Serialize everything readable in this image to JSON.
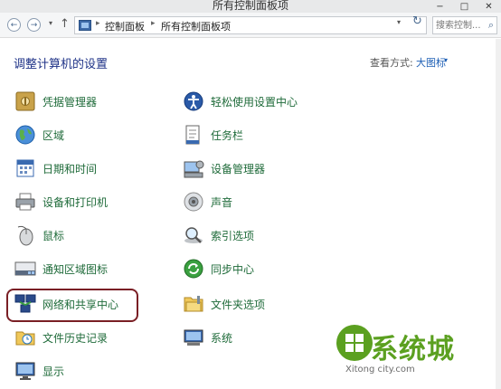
{
  "window": {
    "title": "所有控制面板项",
    "minimize": "−",
    "maximize": "□",
    "close": "✕"
  },
  "address": {
    "back_glyph": "←",
    "forward_glyph": "→",
    "dropdown_glyph": "▾",
    "up_glyph": "↑",
    "refresh_glyph": "↻",
    "sep_glyph": "▸",
    "crumbs": [
      "控制面板",
      "所有控制面板项"
    ]
  },
  "search": {
    "placeholder": "搜索控制...",
    "icon_glyph": "⌕"
  },
  "header": {
    "title": "调整计算机的设置",
    "view_label": "查看方式:",
    "view_value": "大图标",
    "caret": "▾"
  },
  "items": {
    "credential_manager": "凭据管理器",
    "ease_of_access": "轻松使用设置中心",
    "region": "区域",
    "taskbar": "任务栏",
    "date_time": "日期和时间",
    "device_manager": "设备管理器",
    "devices_printers": "设备和打印机",
    "sound": "声音",
    "mouse": "鼠标",
    "indexing": "索引选项",
    "notification_icons": "通知区域图标",
    "sync_center": "同步中心",
    "network_sharing": "网络和共享中心",
    "folder_options": "文件夹选项",
    "file_history": "文件历史记录",
    "system": "系统",
    "display": "显示"
  },
  "watermark": {
    "brand": "系统城",
    "site": "Xitong city.com"
  },
  "colors": {
    "link": "#1f6b3a",
    "heading": "#1e3287",
    "accent": "#1e5fb5",
    "highlight": "#7a1f25",
    "watermark": "#5ba020"
  }
}
